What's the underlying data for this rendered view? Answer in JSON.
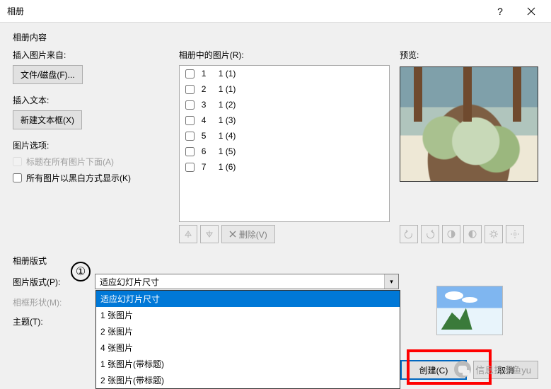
{
  "title": "相册",
  "section_content": "相册内容",
  "section_layout": "相册版式",
  "annotation_num": "①",
  "insert_from_label": "插入图片来自:",
  "file_disk_btn": "文件/磁盘(F)...",
  "insert_text_label": "插入文本:",
  "new_textbox_btn": "新建文本框(X)",
  "options_label": "图片选项:",
  "checkbox_caption": "标题在所有图片下面(A)",
  "checkbox_bw": "所有图片以黑白方式显示(K)",
  "pic_in_album_label": "相册中的图片(R):",
  "preview_label": "预览:",
  "list_items": [
    {
      "idx": "1",
      "name": "1 (1)"
    },
    {
      "idx": "2",
      "name": "1 (1)"
    },
    {
      "idx": "3",
      "name": "1 (2)"
    },
    {
      "idx": "4",
      "name": "1 (3)"
    },
    {
      "idx": "5",
      "name": "1 (4)"
    },
    {
      "idx": "6",
      "name": "1 (5)"
    },
    {
      "idx": "7",
      "name": "1 (6)"
    }
  ],
  "delete_label": "删除(V)",
  "form": {
    "pic_layout_label": "图片版式(P):",
    "frame_shape_label": "相框形状(M):",
    "theme_label": "主题(T):",
    "combo_value": "适应幻灯片尺寸",
    "options": [
      "适应幻灯片尺寸",
      "1 张图片",
      "2 张图片",
      "4 张图片",
      "1 张图片(带标题)",
      "2 张图片(带标题)"
    ]
  },
  "footer": {
    "create": "创建(C)",
    "cancel": "取消"
  },
  "watermark": "信息技术鱼yu"
}
